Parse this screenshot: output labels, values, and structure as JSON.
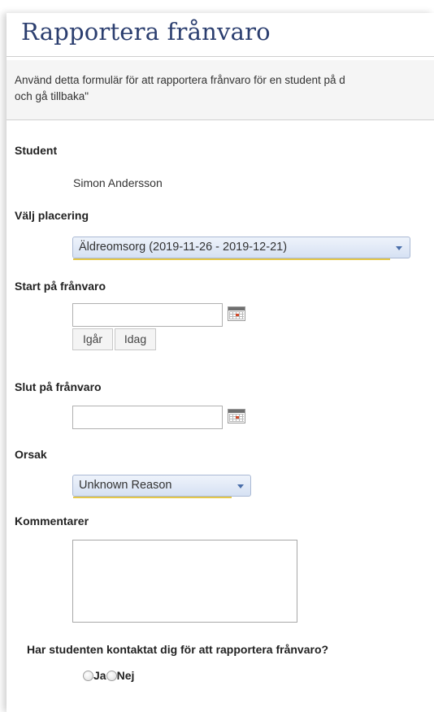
{
  "page": {
    "title": "Rapportera frånvaro",
    "info_text_line1": "Använd detta formulär för att rapportera frånvaro för en student på d",
    "info_text_line2": "och gå tillbaka\""
  },
  "student": {
    "label": "Student",
    "name": "Simon Andersson"
  },
  "placement": {
    "label": "Välj placering",
    "selected": "Äldreomsorg (2019-11-26 - 2019-12-21)"
  },
  "absence_start": {
    "label": "Start på frånvaro",
    "value": "",
    "yesterday_button": "Igår",
    "today_button": "Idag"
  },
  "absence_end": {
    "label": "Slut på frånvaro",
    "value": ""
  },
  "reason": {
    "label": "Orsak",
    "selected": "Unknown Reason"
  },
  "comments": {
    "label": "Kommentarer",
    "value": ""
  },
  "contact_question": {
    "label": "Har studenten kontaktat dig för att rapportera frånvaro?",
    "option_yes": "Ja",
    "option_no": "Nej"
  },
  "icons": {
    "calendar": "calendar-icon",
    "dropdown": "chevron-down-icon"
  },
  "colors": {
    "title": "#2b3e6f",
    "select_accent": "#e5c84a",
    "select_bg": "#dde6f5"
  }
}
